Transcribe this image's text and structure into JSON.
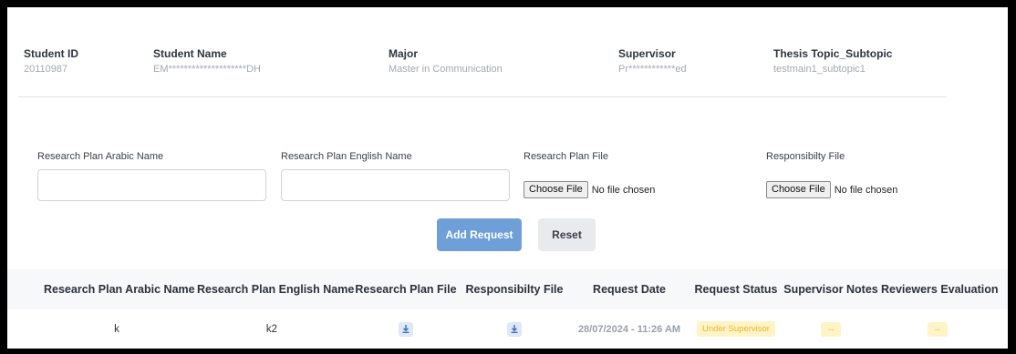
{
  "student_info": {
    "student_id": {
      "label": "Student ID",
      "value": "20110987"
    },
    "student_name": {
      "label": "Student Name",
      "value": "EM********************DH"
    },
    "major": {
      "label": "Major",
      "value": "Master in Communication"
    },
    "supervisor": {
      "label": "Supervisor",
      "value": "Pr************ed"
    },
    "thesis": {
      "label": "Thesis Topic_Subtopic",
      "value": "testmain1_subtopic1"
    }
  },
  "form": {
    "arabic_name_label": "Research Plan Arabic Name",
    "arabic_name_value": "",
    "english_name_label": "Research Plan English Name",
    "english_name_value": "",
    "plan_file_label": "Research Plan File",
    "responsibility_file_label": "Responsibilty File",
    "choose_file_label": "Choose File",
    "no_file_text": "No file chosen",
    "add_button": "Add Request",
    "reset_button": "Reset"
  },
  "table": {
    "headers": [
      "Research Plan Arabic Name",
      "Research Plan English Name",
      "Research Plan File",
      "Responsibilty File",
      "Request Date",
      "Request Status",
      "Supervisor Notes",
      "Reviewers Evaluation"
    ],
    "rows": [
      {
        "arabic_name": "k",
        "english_name": "k2",
        "plan_file_icon": "download-icon",
        "responsibility_file_icon": "download-icon",
        "request_date": "28/07/2024 - 11:26 AM",
        "status": "Under Supervisor",
        "supervisor_notes": "--",
        "reviewers_evaluation": "--"
      }
    ]
  },
  "colors": {
    "primary": "#6f9fd8",
    "badge_bg": "#fff4c7",
    "badge_text": "#e8b52b"
  }
}
